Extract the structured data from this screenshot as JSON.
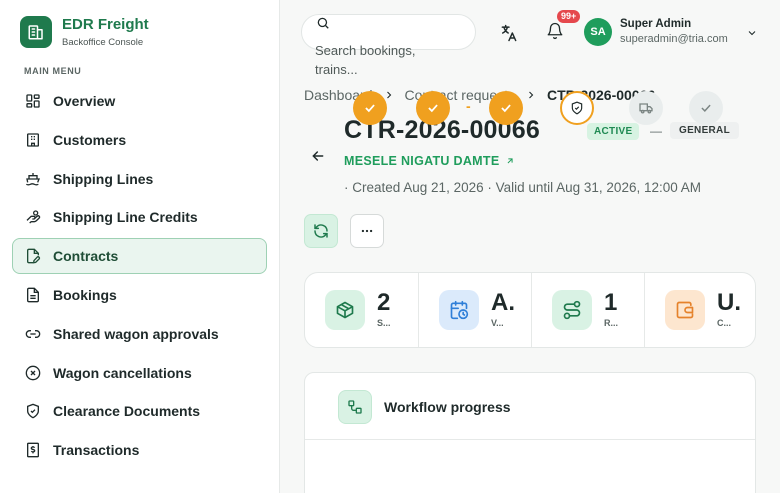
{
  "brand": {
    "name": "EDR Freight",
    "subtitle": "Backoffice Console"
  },
  "sidebar": {
    "section_title": "MAIN MENU",
    "items": [
      {
        "label": "Overview",
        "icon": "grid-icon",
        "active": false
      },
      {
        "label": "Customers",
        "icon": "building-icon",
        "active": false
      },
      {
        "label": "Shipping Lines",
        "icon": "ship-icon",
        "active": false
      },
      {
        "label": "Shipping Line Credits",
        "icon": "hand-coins-icon",
        "active": false
      },
      {
        "label": "Contracts",
        "icon": "file-pen-icon",
        "active": true
      },
      {
        "label": "Bookings",
        "icon": "file-text-icon",
        "active": false
      },
      {
        "label": "Shared wagon approvals",
        "icon": "link-icon",
        "active": false
      },
      {
        "label": "Wagon cancellations",
        "icon": "x-circle-icon",
        "active": false
      },
      {
        "label": "Clearance Documents",
        "icon": "shield-check-icon",
        "active": false
      },
      {
        "label": "Transactions",
        "icon": "receipt-dollar-icon",
        "active": false
      }
    ]
  },
  "header": {
    "search_placeholder": "Search bookings, trains...",
    "notification_count": "99+",
    "user": {
      "initials": "SA",
      "name": "Super Admin",
      "email": "superadmin@tria.com"
    }
  },
  "breadcrumb": {
    "items": [
      "Dashboard",
      "Contract requests"
    ],
    "current": "CTR-2026-00066"
  },
  "contract": {
    "id": "CTR-2026-00066",
    "status": "ACTIVE",
    "separator": "—",
    "type": "GENERAL",
    "customer": "MESELE NIGATU DAMTE",
    "meta": "· Created Aug 21, 2026 · Valid until Aug 31, 2026, 12:00 AM"
  },
  "stats": [
    {
      "value": "2",
      "label": "S...",
      "icon": "package-icon",
      "color": "#d9f2e4"
    },
    {
      "value": "A.",
      "label": "V...",
      "icon": "calendar-clock-icon",
      "color": "#dbeafb"
    },
    {
      "value": "1",
      "label": "R...",
      "icon": "route-icon",
      "color": "#d9f2e4"
    },
    {
      "value": "U.",
      "label": "C...",
      "icon": "wallet-icon",
      "color": "#fde6cf"
    }
  ],
  "workflow": {
    "title": "Workflow progress",
    "connector": "-",
    "steps": [
      {
        "state": "done",
        "icon": "check-icon"
      },
      {
        "state": "done",
        "icon": "check-icon"
      },
      {
        "state": "done",
        "icon": "check-icon"
      },
      {
        "state": "current",
        "icon": "shield-check-icon"
      },
      {
        "state": "pending",
        "icon": "truck-icon"
      },
      {
        "state": "pending",
        "icon": "check-icon"
      }
    ]
  },
  "colors": {
    "primary": "#1f7a4d",
    "accent_green": "#1f9d5c",
    "orange": "#f0a01f",
    "badge_red": "#e5484d"
  }
}
